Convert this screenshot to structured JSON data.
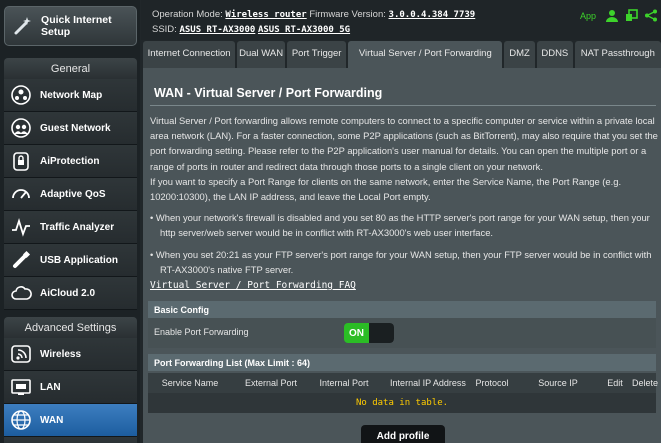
{
  "sidebar": {
    "quick_setup": "Quick Internet Setup",
    "general_heading": "General",
    "general_items": [
      {
        "label": "Network Map",
        "icon": "network-map-icon"
      },
      {
        "label": "Guest Network",
        "icon": "guest-network-icon"
      },
      {
        "label": "AiProtection",
        "icon": "lock-icon"
      },
      {
        "label": "Adaptive QoS",
        "icon": "speedometer-icon"
      },
      {
        "label": "Traffic Analyzer",
        "icon": "traffic-analyzer-icon"
      },
      {
        "label": "USB Application",
        "icon": "usb-icon"
      },
      {
        "label": "AiCloud 2.0",
        "icon": "cloud-icon"
      }
    ],
    "advanced_heading": "Advanced Settings",
    "advanced_items": [
      {
        "label": "Wireless",
        "icon": "wireless-icon"
      },
      {
        "label": "LAN",
        "icon": "lan-icon"
      },
      {
        "label": "WAN",
        "icon": "globe-icon",
        "active": true
      }
    ]
  },
  "topbar": {
    "op_mode_label": "Operation Mode:",
    "op_mode_value": "Wireless router",
    "firmware_label": "Firmware Version:",
    "firmware_value": "3.0.0.4.384_7739",
    "ssid_label": "SSID:",
    "ssid_1": "ASUS_RT-AX3000",
    "ssid_2": "ASUS_RT-AX3000_5G",
    "app_label": "App",
    "icons": [
      "user-icon",
      "usb-status-icon",
      "share-icon"
    ],
    "status_color": "#3dd32b"
  },
  "tabs": [
    {
      "label": "Internet Connection"
    },
    {
      "label": "Dual WAN"
    },
    {
      "label": "Port Trigger"
    },
    {
      "label": "Virtual Server / Port Forwarding",
      "active": true
    },
    {
      "label": "DMZ"
    },
    {
      "label": "DDNS"
    },
    {
      "label": "NAT Passthrough"
    }
  ],
  "page": {
    "title": "WAN - Virtual Server / Port Forwarding",
    "intro": "Virtual Server / Port forwarding allows remote computers to connect to a specific computer or service within a private local area network (LAN). For a faster connection, some P2P applications (such as BitTorrent), may also require that you set the port forwarding setting. Please refer to the P2P application's user manual for details. You can open the multiple port or a range of ports in router and redirect data through those ports to a single client on your network.",
    "intro2": "If you want to specify a Port Range for clients on the same network, enter the Service Name, the Port Range (e.g. 10200:10300), the LAN IP address, and leave the Local Port empty.",
    "bullets": [
      "When your network's firewall is disabled and you set 80 as the HTTP server's port range for your WAN setup, then your http server/web server would be in conflict with RT-AX3000's web user interface.",
      "When you set 20:21 as your FTP server's port range for your WAN setup, then your FTP server would be in conflict with RT-AX3000's native FTP server."
    ],
    "faq_link": "Virtual Server / Port Forwarding FAQ",
    "basic_config": "Basic Config",
    "enable_label": "Enable Port Forwarding",
    "toggle_state": "ON",
    "list_heading": "Port Forwarding List (Max Limit : 64)",
    "columns": [
      "Service Name",
      "External Port",
      "Internal Port",
      "Internal IP Address",
      "Protocol",
      "Source IP",
      "Edit",
      "Delete"
    ],
    "no_data": "No data in table.",
    "add_button": "Add profile"
  }
}
